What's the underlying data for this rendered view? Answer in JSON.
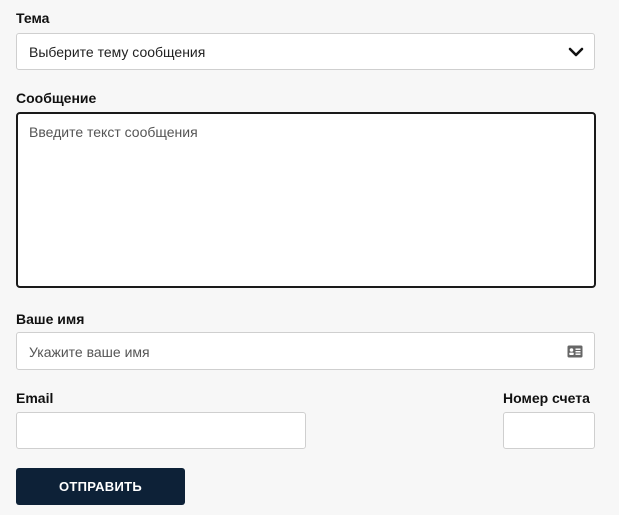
{
  "form": {
    "topic": {
      "label": "Тема",
      "selected": "Выберите тему сообщения",
      "icon": "chevron-down-icon"
    },
    "message": {
      "label": "Сообщение",
      "placeholder": "Введите текст сообщения"
    },
    "name": {
      "label": "Ваше имя",
      "placeholder": "Укажите ваше имя",
      "icon": "contact-card-icon"
    },
    "email": {
      "label": "Email",
      "value": ""
    },
    "account": {
      "label": "Номер счета",
      "value": ""
    },
    "submit_label": "ОТПРАВИТЬ"
  },
  "colors": {
    "background": "#f7f7f7",
    "button": "#0d2137",
    "button_text": "#ffffff",
    "field_border": "#cfcfcf",
    "active_border": "#1a1a1a"
  }
}
